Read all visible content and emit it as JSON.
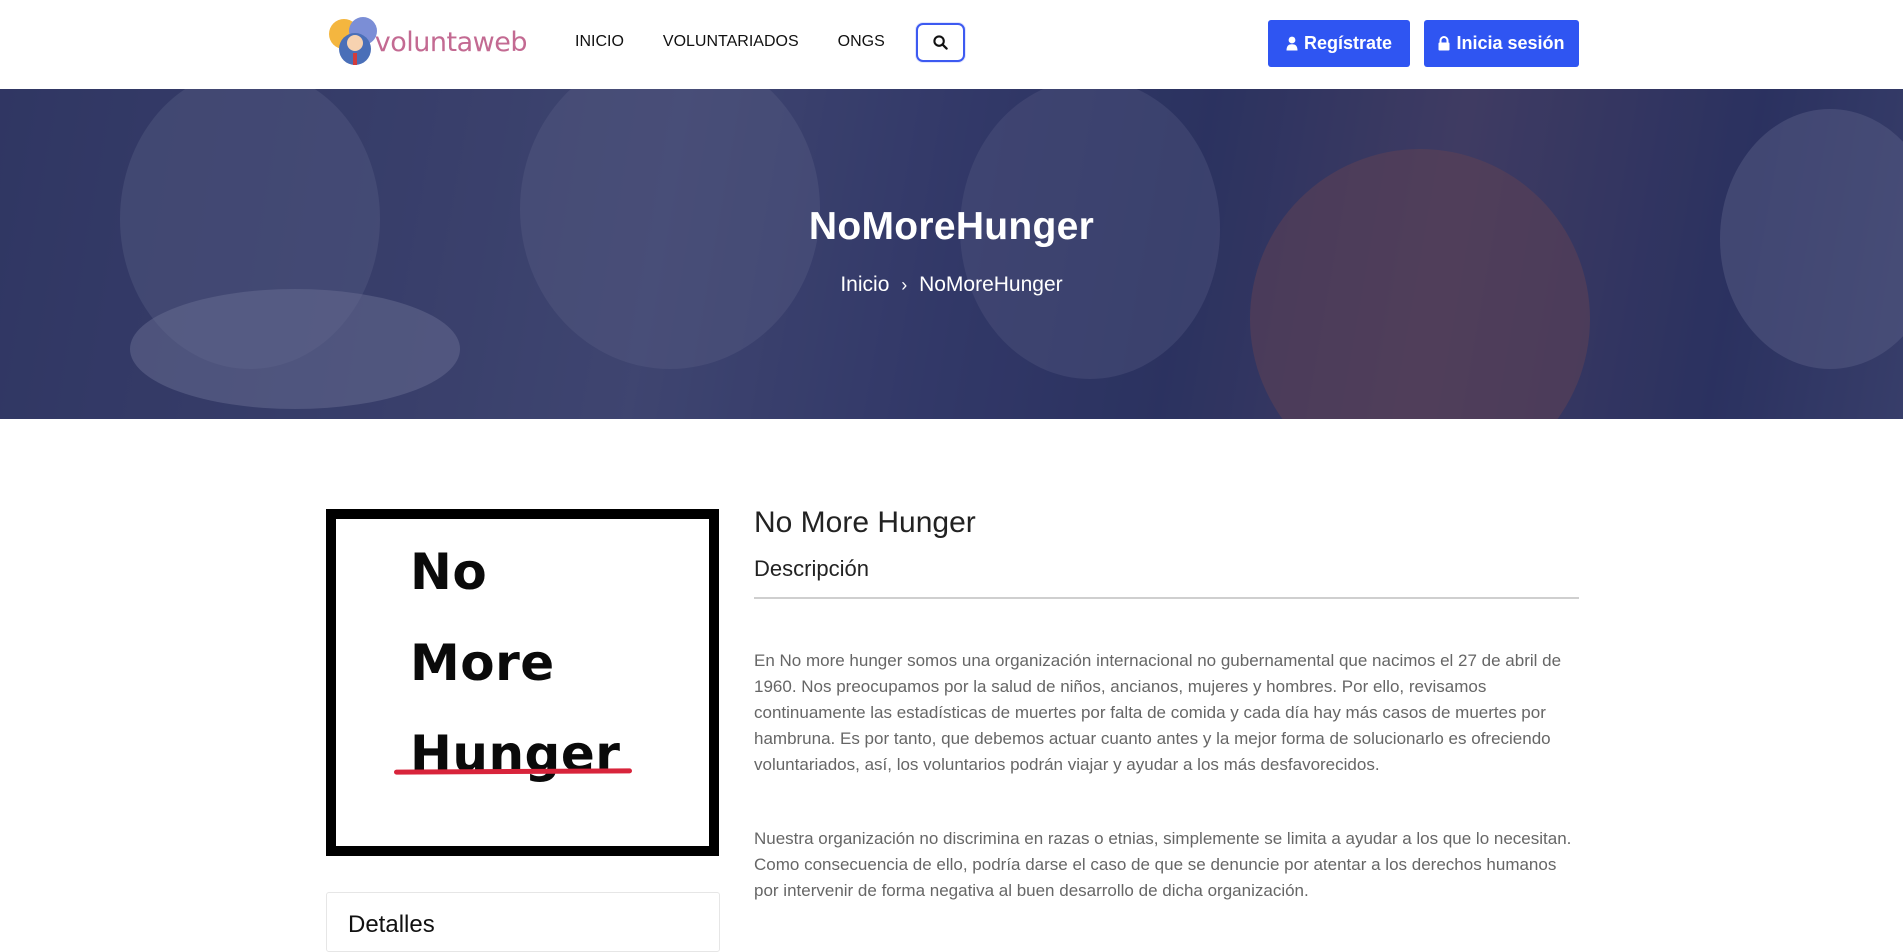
{
  "navbar": {
    "logo_text": "voluntaweb",
    "links": [
      "INICIO",
      "VOLUNTARIADOS",
      "ONGS"
    ],
    "search_icon": "search-icon",
    "register_label": "Regístrate",
    "login_label": "Inicia sesión",
    "accent_color": "#2f55f2"
  },
  "hero": {
    "title": "NoMoreHunger",
    "breadcrumb": {
      "home": "Inicio",
      "separator": "›",
      "current": "NoMoreHunger"
    }
  },
  "org": {
    "image_words": [
      "No",
      "More",
      "Hunger"
    ],
    "name": "No More Hunger",
    "description_heading": "Descripción",
    "paragraphs": [
      "En No more hunger somos una organización internacional no gubernamental que nacimos el 27 de abril de 1960. Nos preocupamos por la salud de niños, ancianos, mujeres y hombres. Por ello, revisamos continuamente las estadísticas de muertes por falta de comida y cada día hay más casos de muertes por hambruna. Es por tanto, que debemos actuar cuanto antes y la mejor forma de solucionarlo es ofreciendo voluntariados, así, los voluntarios podrán viajar y ayudar a los más desfavorecidos.",
      "Nuestra organización no discrimina en razas o etnias, simplemente se limita a ayudar a los que lo necesitan. Como consecuencia de ello, podría darse el caso de que se denuncie por atentar a los derechos humanos por intervenir de forma negativa al buen desarrollo de dicha organización."
    ],
    "details_heading": "Detalles"
  }
}
